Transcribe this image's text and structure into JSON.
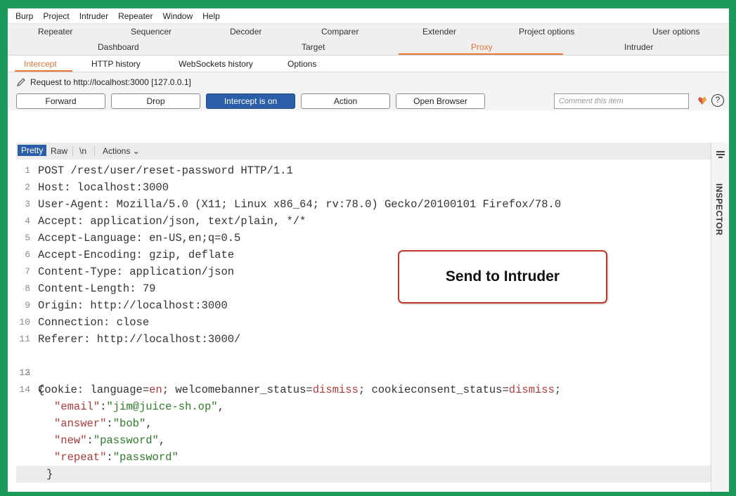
{
  "menu": [
    "Burp",
    "Project",
    "Intruder",
    "Repeater",
    "Window",
    "Help"
  ],
  "tool_tabs_row1": [
    "Repeater",
    "Sequencer",
    "Decoder",
    "Comparer",
    "Extender",
    "Project options",
    "User options"
  ],
  "tool_tabs_row2": [
    "Dashboard",
    "Target",
    "Proxy",
    "Intruder"
  ],
  "active_tool_tab": "Proxy",
  "sub_tabs": [
    "Intercept",
    "HTTP history",
    "WebSockets history",
    "Options"
  ],
  "active_sub_tab": "Intercept",
  "request_info": "Request to http://localhost:3000  [127.0.0.1]",
  "buttons": {
    "forward": "Forward",
    "drop": "Drop",
    "intercept": "Intercept is on",
    "action": "Action",
    "open_browser": "Open Browser"
  },
  "comment_placeholder": "Comment this item",
  "help_symbol": "?",
  "editor_tabs": [
    "Pretty",
    "Raw",
    "\\n",
    "Actions ⌄"
  ],
  "active_editor_tab": "Pretty",
  "inspector_label": "INSPECTOR",
  "lines": [
    {
      "n": "1",
      "text": "POST /rest/user/reset-password HTTP/1.1"
    },
    {
      "n": "2",
      "text": "Host: localhost:3000"
    },
    {
      "n": "3",
      "text": "User-Agent: Mozilla/5.0 (X11; Linux x86_64; rv:78.0) Gecko/20100101 Firefox/78.0"
    },
    {
      "n": "4",
      "text": "Accept: application/json, text/plain, */*"
    },
    {
      "n": "5",
      "text": "Accept-Language: en-US,en;q=0.5"
    },
    {
      "n": "6",
      "text": "Accept-Encoding: gzip, deflate"
    },
    {
      "n": "7",
      "text": "Content-Type: application/json"
    },
    {
      "n": "8",
      "text": "Content-Length: 79"
    },
    {
      "n": "9",
      "text": "Origin: http://localhost:3000"
    },
    {
      "n": "10",
      "text": "Connection: close"
    },
    {
      "n": "11",
      "text": "Referer: http://localhost:3000/"
    }
  ],
  "cookie_line": {
    "n": "12",
    "prefix": "Cookie: ",
    "k1": "language",
    "eq1": "=",
    "v1": "en",
    "sep1": "; ",
    "k2": "welcomebanner_status",
    "eq2": "=",
    "v2": "dismiss",
    "sep2": "; ",
    "k3": "cookieconsent_status",
    "eq3": "=",
    "v3": "dismiss",
    "end": ";"
  },
  "blank_line": {
    "n": "13"
  },
  "json_open": {
    "n": "14",
    "text": "{"
  },
  "json_body": [
    {
      "key": "\"email\"",
      "colon": ":",
      "val": "\"jim@juice-sh.op\"",
      "comma": ","
    },
    {
      "key": "\"answer\"",
      "colon": ":",
      "val": "\"bob\"",
      "comma": ","
    },
    {
      "key": "\"new\"",
      "colon": ":",
      "val": "\"password\"",
      "comma": ","
    },
    {
      "key": "\"repeat\"",
      "colon": ":",
      "val": "\"password\"",
      "comma": ""
    }
  ],
  "json_close": "}",
  "callout": "Send to Intruder",
  "colors": {
    "accent": "#e8743b",
    "primary_button": "#2a5ea8",
    "frame": "#1c9a5a",
    "callout_border": "#c0392b"
  }
}
